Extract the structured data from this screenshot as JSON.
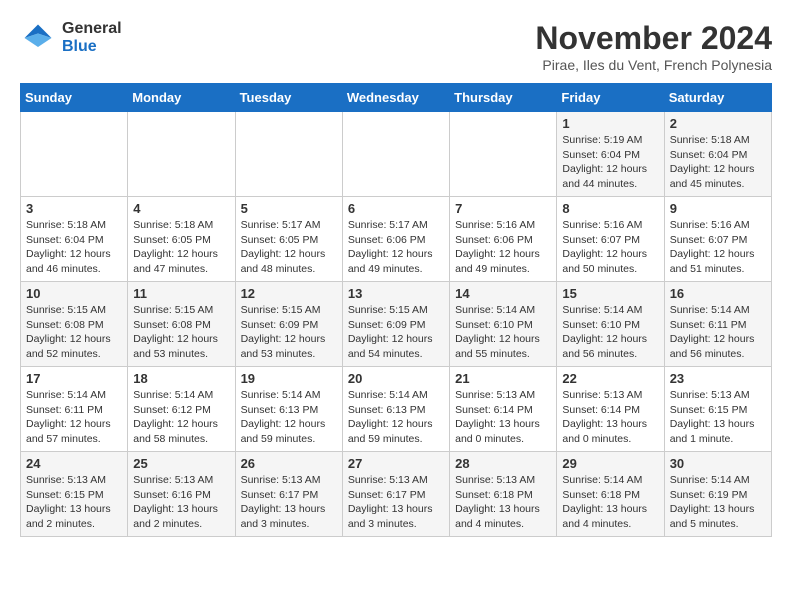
{
  "logo": {
    "general": "General",
    "blue": "Blue"
  },
  "title": "November 2024",
  "subtitle": "Pirae, Iles du Vent, French Polynesia",
  "weekdays": [
    "Sunday",
    "Monday",
    "Tuesday",
    "Wednesday",
    "Thursday",
    "Friday",
    "Saturday"
  ],
  "weeks": [
    [
      {
        "day": "",
        "info": ""
      },
      {
        "day": "",
        "info": ""
      },
      {
        "day": "",
        "info": ""
      },
      {
        "day": "",
        "info": ""
      },
      {
        "day": "",
        "info": ""
      },
      {
        "day": "1",
        "info": "Sunrise: 5:19 AM\nSunset: 6:04 PM\nDaylight: 12 hours\nand 44 minutes."
      },
      {
        "day": "2",
        "info": "Sunrise: 5:18 AM\nSunset: 6:04 PM\nDaylight: 12 hours\nand 45 minutes."
      }
    ],
    [
      {
        "day": "3",
        "info": "Sunrise: 5:18 AM\nSunset: 6:04 PM\nDaylight: 12 hours\nand 46 minutes."
      },
      {
        "day": "4",
        "info": "Sunrise: 5:18 AM\nSunset: 6:05 PM\nDaylight: 12 hours\nand 47 minutes."
      },
      {
        "day": "5",
        "info": "Sunrise: 5:17 AM\nSunset: 6:05 PM\nDaylight: 12 hours\nand 48 minutes."
      },
      {
        "day": "6",
        "info": "Sunrise: 5:17 AM\nSunset: 6:06 PM\nDaylight: 12 hours\nand 49 minutes."
      },
      {
        "day": "7",
        "info": "Sunrise: 5:16 AM\nSunset: 6:06 PM\nDaylight: 12 hours\nand 49 minutes."
      },
      {
        "day": "8",
        "info": "Sunrise: 5:16 AM\nSunset: 6:07 PM\nDaylight: 12 hours\nand 50 minutes."
      },
      {
        "day": "9",
        "info": "Sunrise: 5:16 AM\nSunset: 6:07 PM\nDaylight: 12 hours\nand 51 minutes."
      }
    ],
    [
      {
        "day": "10",
        "info": "Sunrise: 5:15 AM\nSunset: 6:08 PM\nDaylight: 12 hours\nand 52 minutes."
      },
      {
        "day": "11",
        "info": "Sunrise: 5:15 AM\nSunset: 6:08 PM\nDaylight: 12 hours\nand 53 minutes."
      },
      {
        "day": "12",
        "info": "Sunrise: 5:15 AM\nSunset: 6:09 PM\nDaylight: 12 hours\nand 53 minutes."
      },
      {
        "day": "13",
        "info": "Sunrise: 5:15 AM\nSunset: 6:09 PM\nDaylight: 12 hours\nand 54 minutes."
      },
      {
        "day": "14",
        "info": "Sunrise: 5:14 AM\nSunset: 6:10 PM\nDaylight: 12 hours\nand 55 minutes."
      },
      {
        "day": "15",
        "info": "Sunrise: 5:14 AM\nSunset: 6:10 PM\nDaylight: 12 hours\nand 56 minutes."
      },
      {
        "day": "16",
        "info": "Sunrise: 5:14 AM\nSunset: 6:11 PM\nDaylight: 12 hours\nand 56 minutes."
      }
    ],
    [
      {
        "day": "17",
        "info": "Sunrise: 5:14 AM\nSunset: 6:11 PM\nDaylight: 12 hours\nand 57 minutes."
      },
      {
        "day": "18",
        "info": "Sunrise: 5:14 AM\nSunset: 6:12 PM\nDaylight: 12 hours\nand 58 minutes."
      },
      {
        "day": "19",
        "info": "Sunrise: 5:14 AM\nSunset: 6:13 PM\nDaylight: 12 hours\nand 59 minutes."
      },
      {
        "day": "20",
        "info": "Sunrise: 5:14 AM\nSunset: 6:13 PM\nDaylight: 12 hours\nand 59 minutes."
      },
      {
        "day": "21",
        "info": "Sunrise: 5:13 AM\nSunset: 6:14 PM\nDaylight: 13 hours\nand 0 minutes."
      },
      {
        "day": "22",
        "info": "Sunrise: 5:13 AM\nSunset: 6:14 PM\nDaylight: 13 hours\nand 0 minutes."
      },
      {
        "day": "23",
        "info": "Sunrise: 5:13 AM\nSunset: 6:15 PM\nDaylight: 13 hours\nand 1 minute."
      }
    ],
    [
      {
        "day": "24",
        "info": "Sunrise: 5:13 AM\nSunset: 6:15 PM\nDaylight: 13 hours\nand 2 minutes."
      },
      {
        "day": "25",
        "info": "Sunrise: 5:13 AM\nSunset: 6:16 PM\nDaylight: 13 hours\nand 2 minutes."
      },
      {
        "day": "26",
        "info": "Sunrise: 5:13 AM\nSunset: 6:17 PM\nDaylight: 13 hours\nand 3 minutes."
      },
      {
        "day": "27",
        "info": "Sunrise: 5:13 AM\nSunset: 6:17 PM\nDaylight: 13 hours\nand 3 minutes."
      },
      {
        "day": "28",
        "info": "Sunrise: 5:13 AM\nSunset: 6:18 PM\nDaylight: 13 hours\nand 4 minutes."
      },
      {
        "day": "29",
        "info": "Sunrise: 5:14 AM\nSunset: 6:18 PM\nDaylight: 13 hours\nand 4 minutes."
      },
      {
        "day": "30",
        "info": "Sunrise: 5:14 AM\nSunset: 6:19 PM\nDaylight: 13 hours\nand 5 minutes."
      }
    ]
  ]
}
